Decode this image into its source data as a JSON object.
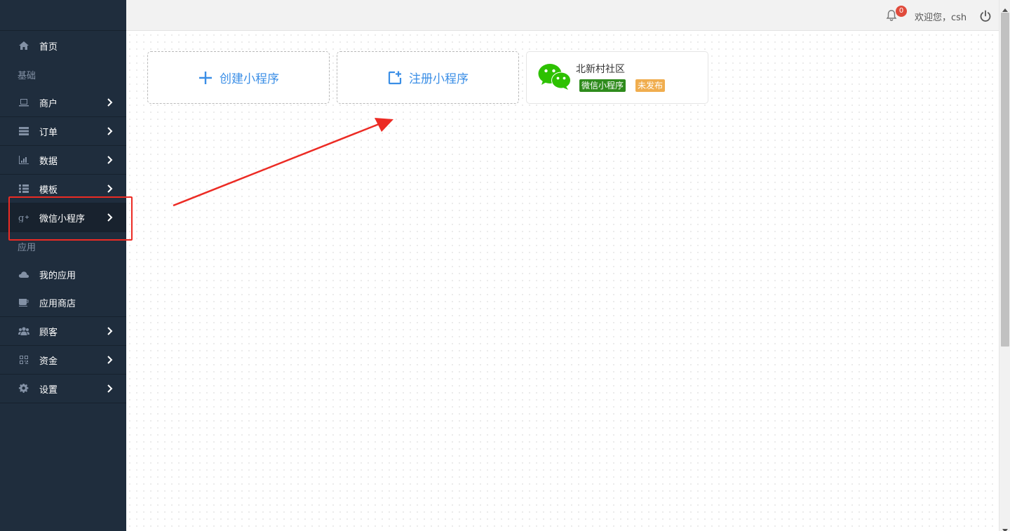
{
  "sidebar": {
    "home": {
      "label": "首页",
      "icon": "home-icon"
    },
    "section_basic": "基础",
    "basic_items": [
      {
        "label": "商户",
        "icon": "laptop-icon"
      },
      {
        "label": "订单",
        "icon": "list-icon"
      },
      {
        "label": "数据",
        "icon": "bar-chart-icon"
      },
      {
        "label": "模板",
        "icon": "list-ul-icon"
      },
      {
        "label": "微信小程序",
        "icon": "google-plus-icon"
      }
    ],
    "section_apps": "应用",
    "app_items": [
      {
        "label": "我的应用",
        "icon": "cloud-icon"
      },
      {
        "label": "应用商店",
        "icon": "coffee-icon"
      }
    ],
    "more_items": [
      {
        "label": "顾客",
        "icon": "users-icon"
      },
      {
        "label": "资金",
        "icon": "qrcode-icon"
      },
      {
        "label": "设置",
        "icon": "gear-icon"
      }
    ]
  },
  "topbar": {
    "notification_count": "0",
    "welcome_text": "欢迎您，csh"
  },
  "main": {
    "create_label": "创建小程序",
    "register_label": "注册小程序",
    "app": {
      "name": "北新村社区",
      "type_tag": "微信小程序",
      "status_tag": "未发布"
    }
  },
  "colors": {
    "sidebar_bg": "#1f2d3d",
    "accent": "#3a8ee6",
    "wechat_green": "#2e8b1c",
    "status_orange": "#f0ad4e",
    "annotation_red": "#ec2b24"
  }
}
